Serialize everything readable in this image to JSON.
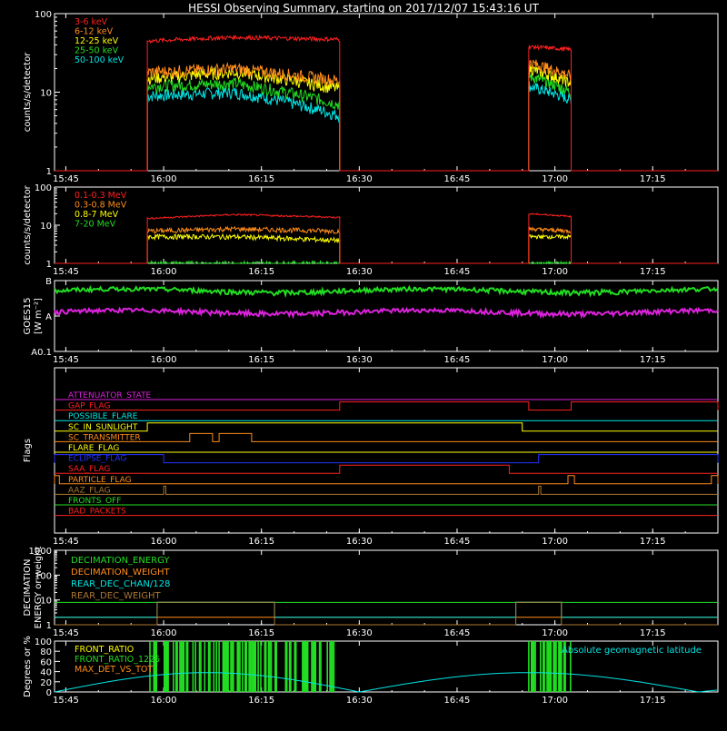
{
  "title": "HESSI Observing Summary, starting on 2017/12/07 15:43:16 UT",
  "time_axis": {
    "start": "15:43:16",
    "end": "17:25:00",
    "ticks": [
      "15:45",
      "16:00",
      "16:15",
      "16:30",
      "16:45",
      "17:00",
      "17:15"
    ]
  },
  "colors": {
    "red": "#ff2020",
    "orange": "#ff8c1a",
    "yellow": "#ffff00",
    "green": "#22dd22",
    "cyan": "#00e5e5",
    "magenta": "#dd22dd",
    "blue": "#2233ff",
    "brown": "#aa7733",
    "white": "#ffffff"
  },
  "chart_data": [
    {
      "type": "line",
      "id": "lo-energy",
      "ylabel": "counts/s/detector",
      "yscale": "log",
      "ylim": [
        1,
        100
      ],
      "yticks": [
        "1",
        "10",
        "100"
      ],
      "observing_intervals": [
        [
          "15:57:30",
          "16:27:00"
        ],
        [
          "16:56:00",
          "17:02:30"
        ]
      ],
      "series": [
        {
          "name": "3-6 keV",
          "color": "red",
          "levels": [
            45,
            50,
            47
          ],
          "end_levels": [
            38,
            35
          ]
        },
        {
          "name": "6-12 keV",
          "color": "orange",
          "levels": [
            18,
            20,
            14
          ],
          "end_levels": [
            24,
            16
          ]
        },
        {
          "name": "12-25 keV",
          "color": "yellow",
          "levels": [
            15,
            18,
            11
          ],
          "end_levels": [
            20,
            13
          ]
        },
        {
          "name": "25-50 keV",
          "color": "green",
          "levels": [
            12,
            13,
            7
          ],
          "end_levels": [
            16,
            10
          ]
        },
        {
          "name": "50-100 keV",
          "color": "cyan",
          "levels": [
            9,
            10,
            5
          ],
          "end_levels": [
            12,
            8
          ]
        }
      ]
    },
    {
      "type": "line",
      "id": "hi-energy",
      "ylabel": "counts/s/detector",
      "yscale": "log",
      "ylim": [
        1,
        100
      ],
      "yticks": [
        "1",
        "10",
        "100"
      ],
      "observing_intervals": [
        [
          "15:57:30",
          "16:27:00"
        ],
        [
          "16:56:00",
          "17:02:30"
        ]
      ],
      "series": [
        {
          "name": "0.1-0.3 MeV",
          "color": "red",
          "levels": [
            15,
            19,
            16
          ],
          "end_levels": [
            20,
            17
          ]
        },
        {
          "name": "0.3-0.8 MeV",
          "color": "orange",
          "levels": [
            7,
            8,
            7
          ],
          "end_levels": [
            8,
            7
          ]
        },
        {
          "name": "0.8-7 MeV",
          "color": "yellow",
          "levels": [
            5,
            5,
            4
          ],
          "end_levels": [
            5,
            5
          ]
        },
        {
          "name": "7-20 MeV",
          "color": "green",
          "levels": [
            1,
            1,
            1
          ],
          "end_levels": [
            1,
            1
          ]
        }
      ]
    },
    {
      "type": "line",
      "id": "goes",
      "ylabel": "GOES15",
      "ylabel2": "[W m⁻²]",
      "yscale": "log",
      "ylim": [
        1e-09,
        1e-07
      ],
      "yticks": [
        "A0.1",
        "A",
        "B"
      ],
      "series": [
        {
          "name": "long",
          "color": "green",
          "level": 5.2e-08
        },
        {
          "name": "short",
          "color": "magenta",
          "level": 1.3e-08
        }
      ]
    },
    {
      "type": "flags",
      "id": "flags",
      "ylabel": "Flags",
      "flags": [
        {
          "name": "ATTENUATOR_STATE",
          "color": "magenta",
          "steps": []
        },
        {
          "name": "GAP_FLAG",
          "color": "red",
          "steps": [
            [
              "16:27:00",
              "16:56:00"
            ],
            [
              "17:02:30",
              "17:25:00"
            ]
          ]
        },
        {
          "name": "POSSIBLE_FLARE",
          "color": "cyan",
          "steps": []
        },
        {
          "name": "SC_IN_SUNLIGHT",
          "color": "yellow",
          "steps": [
            [
              "15:57:30",
              "16:55:00"
            ]
          ]
        },
        {
          "name": "SC_TRANSMITTER",
          "color": "orange",
          "steps": [
            [
              "16:04:00",
              "16:07:30"
            ],
            [
              "16:08:30",
              "16:13:30"
            ]
          ]
        },
        {
          "name": "FLARE_FLAG",
          "color": "yellow",
          "steps": []
        },
        {
          "name": "ECLIPSE_FLAG",
          "color": "blue",
          "steps": [
            [
              "15:43:16",
              "16:00:00"
            ],
            [
              "16:57:30",
              "17:25:00"
            ]
          ]
        },
        {
          "name": "SAA_FLAG",
          "color": "red",
          "steps": [
            [
              "16:27:00",
              "16:53:00"
            ]
          ]
        },
        {
          "name": "PARTICLE_FLAG",
          "color": "orange",
          "steps": [
            [
              "15:43:16",
              "15:44:00"
            ],
            [
              "17:02:00",
              "17:03:00"
            ],
            [
              "17:24:00",
              "17:25:00"
            ]
          ]
        },
        {
          "name": "AAZ_FLAG",
          "color": "brown",
          "steps": [
            [
              "16:00:00",
              "16:00:20"
            ],
            [
              "16:57:30",
              "16:57:50"
            ]
          ]
        },
        {
          "name": "FRONTS_OFF",
          "color": "green",
          "steps": []
        },
        {
          "name": "BAD_PACKETS",
          "color": "red",
          "steps": []
        }
      ]
    },
    {
      "type": "line",
      "id": "decimation",
      "ylabel": "DECIMATION",
      "ylabel2": "ENERGY or weight",
      "yscale": "log",
      "ylim": [
        1,
        1000
      ],
      "yticks": [
        "1",
        "10",
        "100",
        "1000"
      ],
      "series": [
        {
          "name": "DECIMATION_ENERGY",
          "color": "green",
          "level": 8
        },
        {
          "name": "DECIMATION_WEIGHT",
          "color": "orange",
          "level": 2
        },
        {
          "name": "REAR_DEC_CHAN/128",
          "color": "cyan",
          "steps": [
            [
              "15:59:00",
              "16:17:00"
            ],
            [
              "16:54:00",
              "17:01:00"
            ]
          ],
          "high": 8,
          "low": 2
        },
        {
          "name": "REAR_DEC_WEIGHT",
          "color": "brown",
          "steps": [
            [
              "15:59:00",
              "16:17:00"
            ],
            [
              "16:54:00",
              "17:01:00"
            ]
          ],
          "high": 8,
          "low": 1
        }
      ]
    },
    {
      "type": "line",
      "id": "ratios",
      "ylabel": "Degrees or %",
      "ylim": [
        0,
        100
      ],
      "yticks": [
        "0",
        "20",
        "40",
        "60",
        "80",
        "100"
      ],
      "series": [
        {
          "name": "FRONT_RATIO",
          "color": "yellow"
        },
        {
          "name": "FRONT_RATIO_1225",
          "color": "green",
          "spike_intervals": [
            [
              "15:57:30",
              "16:27:00"
            ],
            [
              "16:56:00",
              "17:02:30"
            ]
          ]
        },
        {
          "name": "MAX_DET_VS_TOT",
          "color": "orange"
        },
        {
          "name": "Absolute geomagnetic latitude",
          "color": "cyan",
          "period_min": 93,
          "max": 38,
          "min_at": [
            "15:43:16",
            "16:30:00",
            "17:22:00"
          ]
        }
      ]
    }
  ]
}
